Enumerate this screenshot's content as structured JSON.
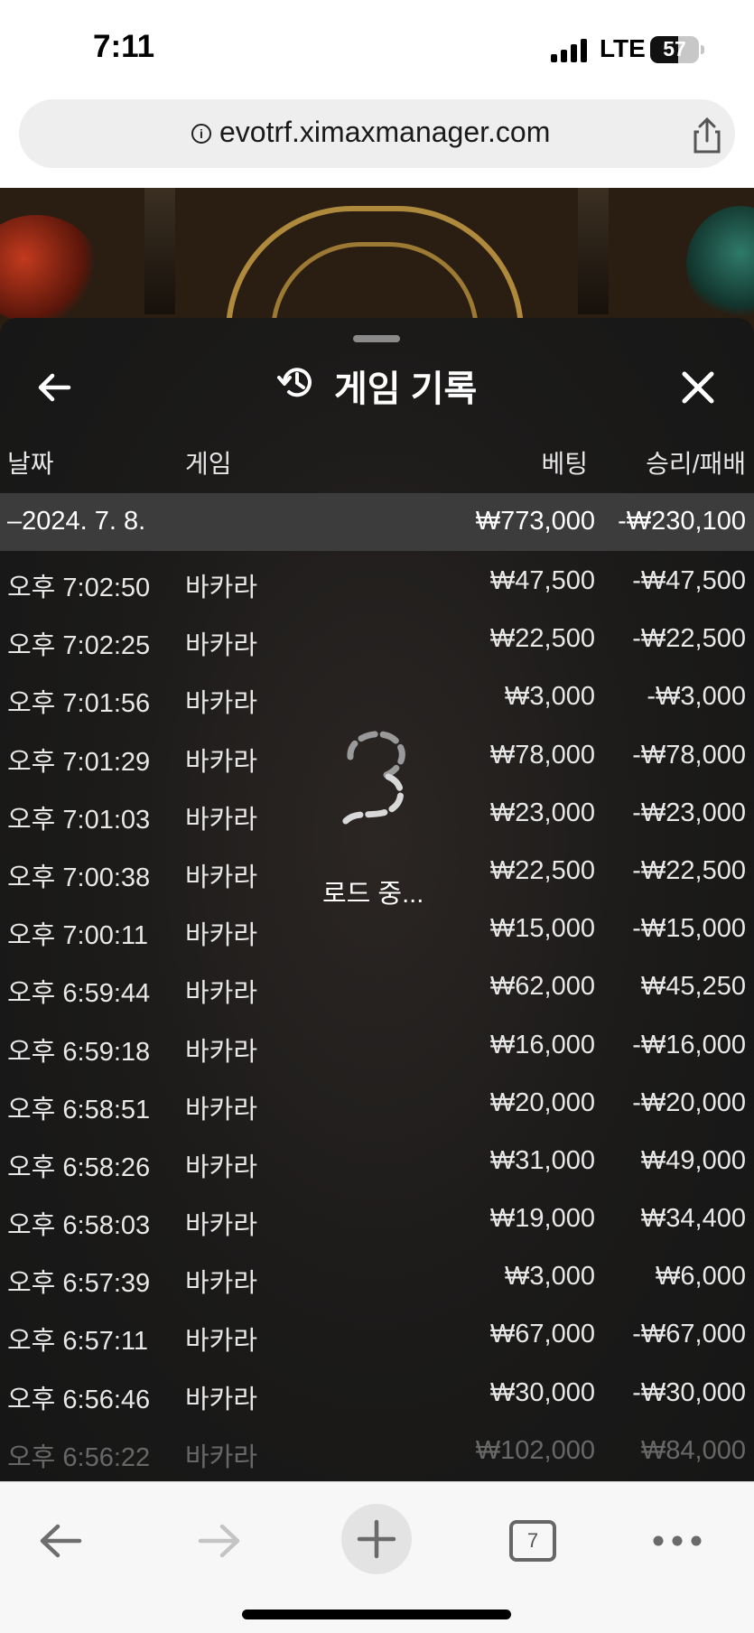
{
  "status_bar": {
    "time": "7:11",
    "network": "LTE",
    "battery": "57",
    "battery_level": 0.57
  },
  "url_bar": {
    "url": "evotrf.ximaxmanager.com"
  },
  "panel": {
    "title": "게임 기록",
    "columns": {
      "date": "날짜",
      "game": "게임",
      "bet": "베팅",
      "win_loss": "승리/패배"
    },
    "date_group": {
      "date": "–2024. 7. 8.",
      "bet_total": "₩773,000",
      "win_loss_total": "-₩230,100"
    },
    "rows": [
      {
        "time": "오후 7:02:50",
        "game": "바카라",
        "bet": "₩47,500",
        "win_loss": "-₩47,500"
      },
      {
        "time": "오후 7:02:25",
        "game": "바카라",
        "bet": "₩22,500",
        "win_loss": "-₩22,500"
      },
      {
        "time": "오후 7:01:56",
        "game": "바카라",
        "bet": "₩3,000",
        "win_loss": "-₩3,000"
      },
      {
        "time": "오후 7:01:29",
        "game": "바카라",
        "bet": "₩78,000",
        "win_loss": "-₩78,000"
      },
      {
        "time": "오후 7:01:03",
        "game": "바카라",
        "bet": "₩23,000",
        "win_loss": "-₩23,000"
      },
      {
        "time": "오후 7:00:38",
        "game": "바카라",
        "bet": "₩22,500",
        "win_loss": "-₩22,500"
      },
      {
        "time": "오후 7:00:11",
        "game": "바카라",
        "bet": "₩15,000",
        "win_loss": "-₩15,000"
      },
      {
        "time": "오후 6:59:44",
        "game": "바카라",
        "bet": "₩62,000",
        "win_loss": "₩45,250"
      },
      {
        "time": "오후 6:59:18",
        "game": "바카라",
        "bet": "₩16,000",
        "win_loss": "-₩16,000"
      },
      {
        "time": "오후 6:58:51",
        "game": "바카라",
        "bet": "₩20,000",
        "win_loss": "-₩20,000"
      },
      {
        "time": "오후 6:58:26",
        "game": "바카라",
        "bet": "₩31,000",
        "win_loss": "₩49,000"
      },
      {
        "time": "오후 6:58:03",
        "game": "바카라",
        "bet": "₩19,000",
        "win_loss": "₩34,400"
      },
      {
        "time": "오후 6:57:39",
        "game": "바카라",
        "bet": "₩3,000",
        "win_loss": "₩6,000"
      },
      {
        "time": "오후 6:57:11",
        "game": "바카라",
        "bet": "₩67,000",
        "win_loss": "-₩67,000"
      },
      {
        "time": "오후 6:56:46",
        "game": "바카라",
        "bet": "₩30,000",
        "win_loss": "-₩30,000"
      },
      {
        "time": "오후 6:56:22",
        "game": "바카라",
        "bet": "₩102,000",
        "win_loss": "₩84,000"
      }
    ],
    "loading_text": "로드 중..."
  },
  "toolbar": {
    "tab_count": "7"
  },
  "icons": {
    "back": "arrow-left-icon",
    "close": "close-icon",
    "history": "history-icon",
    "spinner": "loading-spinner-icon",
    "share": "share-icon",
    "info": "info-icon",
    "new_tab": "plus-icon",
    "more": "more-dots-icon"
  }
}
